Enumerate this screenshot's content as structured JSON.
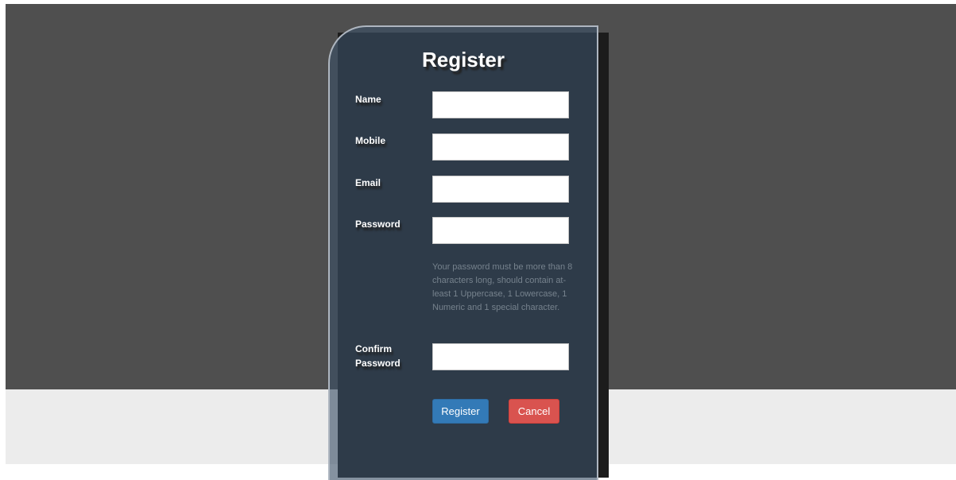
{
  "form": {
    "title": "Register",
    "fields": {
      "name": {
        "label": "Name",
        "value": "",
        "placeholder": ""
      },
      "mobile": {
        "label": "Mobile",
        "value": "",
        "placeholder": ""
      },
      "email": {
        "label": "Email",
        "value": "",
        "placeholder": ""
      },
      "password": {
        "label": "Password",
        "value": "",
        "placeholder": ""
      },
      "confirm_password": {
        "label": "Confirm Password",
        "value": "",
        "placeholder": ""
      }
    },
    "password_hint": "Your password must be more than 8 characters long, should contain at-least 1 Uppercase, 1 Lowercase, 1 Numeric and 1 special character.",
    "buttons": {
      "register": "Register",
      "cancel": "Cancel"
    }
  },
  "colors": {
    "page_dark": "#4f4f4f",
    "page_light": "#ececec",
    "panel": "#3a4f66",
    "register_button": "#337ab7",
    "cancel_button": "#d9534f",
    "hint_text": "#76828d"
  }
}
